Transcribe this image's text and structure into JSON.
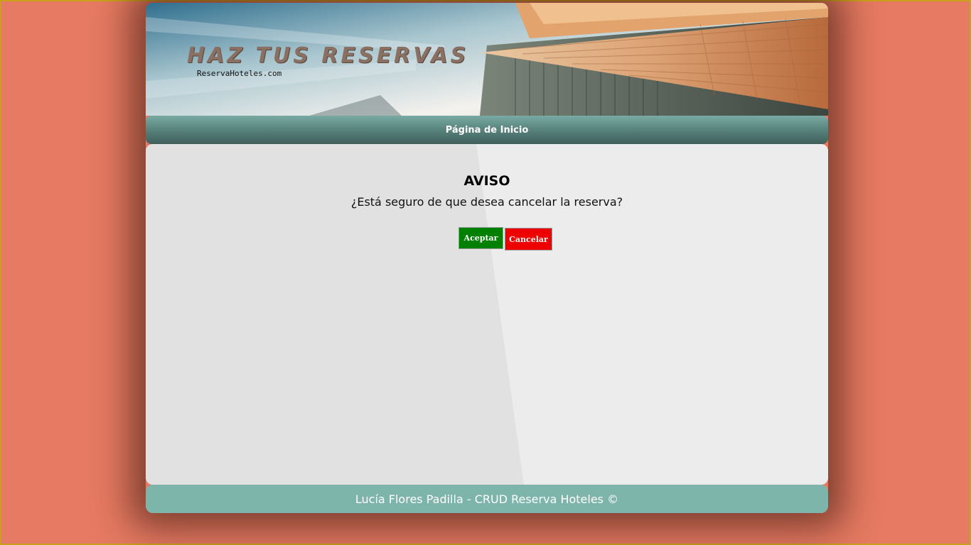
{
  "banner": {
    "title": "HAZ TUS RESERVAS",
    "subtitle": "ReservaHoteles.com"
  },
  "nav": {
    "home_label": "Página de Inicio"
  },
  "dialog": {
    "heading": "AVISO",
    "message": "¿Está seguro de que desea cancelar la reserva?",
    "accept_label": "Aceptar",
    "cancel_label": "Cancelar"
  },
  "footer": {
    "text": "Lucía Flores Padilla - CRUD Reserva Hoteles ©"
  },
  "colors": {
    "page_background": "#e67a62",
    "page_border": "#c9a21a",
    "nav_background": "#5b8680",
    "footer_background": "#7db5ab",
    "content_background": "#e2e2e2",
    "accept_button": "#008000",
    "cancel_button": "#ee0000"
  }
}
